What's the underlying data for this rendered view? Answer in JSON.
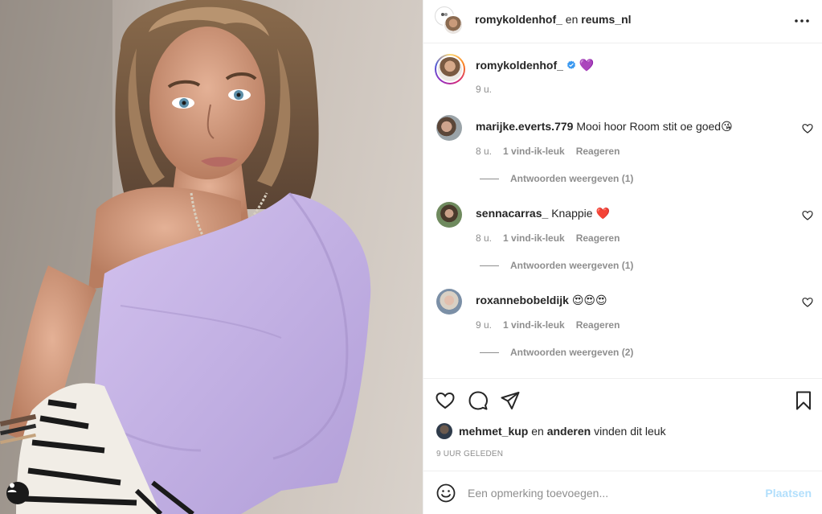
{
  "header": {
    "author": "romykoldenhof_",
    "separator": "en",
    "coauthor": "reums_nl"
  },
  "caption": {
    "username": "romykoldenhof_",
    "emoji": "💜",
    "time": "9 u."
  },
  "comments": [
    {
      "username": "marijke.everts.779",
      "text": "Mooi hoor Room stit oe goed😘",
      "time": "8 u.",
      "likes": "1 vind-ik-leuk",
      "reply": "Reageren",
      "view_replies": "Antwoorden weergeven (1)"
    },
    {
      "username": "sennacarras_",
      "text": "Knappie ❤️",
      "time": "8 u.",
      "likes": "1 vind-ik-leuk",
      "reply": "Reageren",
      "view_replies": "Antwoorden weergeven (1)"
    },
    {
      "username": "roxannebobeldijk",
      "text": "😍😍😍",
      "time": "9 u.",
      "likes": "1 vind-ik-leuk",
      "reply": "Reageren",
      "view_replies": "Antwoorden weergeven (2)"
    }
  ],
  "likes": {
    "user": "mehmet_kup",
    "and": "en",
    "others": "anderen",
    "suffix": "vinden dit leuk"
  },
  "timestamp": "9 UUR GELEDEN",
  "add_comment": {
    "placeholder": "Een opmerking toevoegen...",
    "post_label": "Plaatsen"
  },
  "icons": {
    "more": "more-horizontal-icon",
    "like": "heart-icon",
    "comment": "comment-bubble-icon",
    "share": "paper-plane-icon",
    "save": "bookmark-icon",
    "emoji": "smiley-icon",
    "tag": "user-tag-icon",
    "verified": "verified-badge-icon"
  },
  "colors": {
    "verified": "#3897f0",
    "post_button_disabled": "#b2dffc",
    "secondary_text": "#8e8e8e",
    "top_lavender": "#c9b6e6"
  }
}
